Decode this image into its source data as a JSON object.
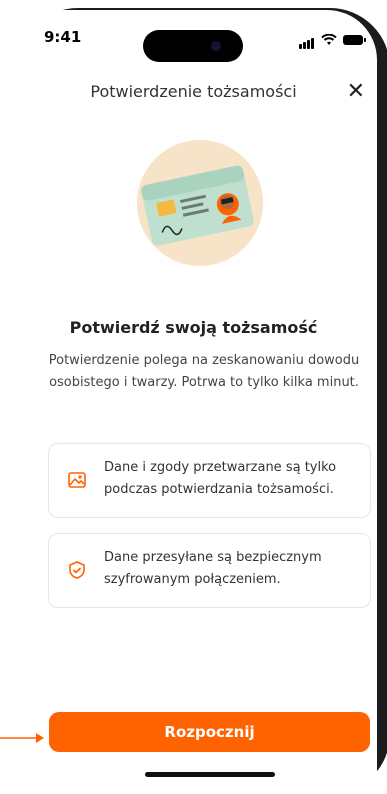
{
  "status_bar": {
    "time": "9:41"
  },
  "header": {
    "title": "Potwierdzenie tożsamości",
    "close_icon": "close-icon"
  },
  "content": {
    "title": "Potwierdź swoją tożsamość",
    "subtitle": "Potwierdzenie polega na zeskanowaniu dowodu osobistego i twarzy. Potrwa to tylko kilka minut."
  },
  "info_cards": [
    {
      "icon": "image-document-icon",
      "text": "Dane i zgody przetwarzane są tylko podczas potwierdzania tożsamości."
    },
    {
      "icon": "shield-check-icon",
      "text": "Dane przesyłane są bezpiecznym szyfrowanym połączeniem."
    }
  ],
  "cta": {
    "label": "Rozpocznij"
  },
  "colors": {
    "accent": "#ff6200",
    "card_border": "#e6e6e6",
    "illustration_bg": "#f7e3c8"
  }
}
